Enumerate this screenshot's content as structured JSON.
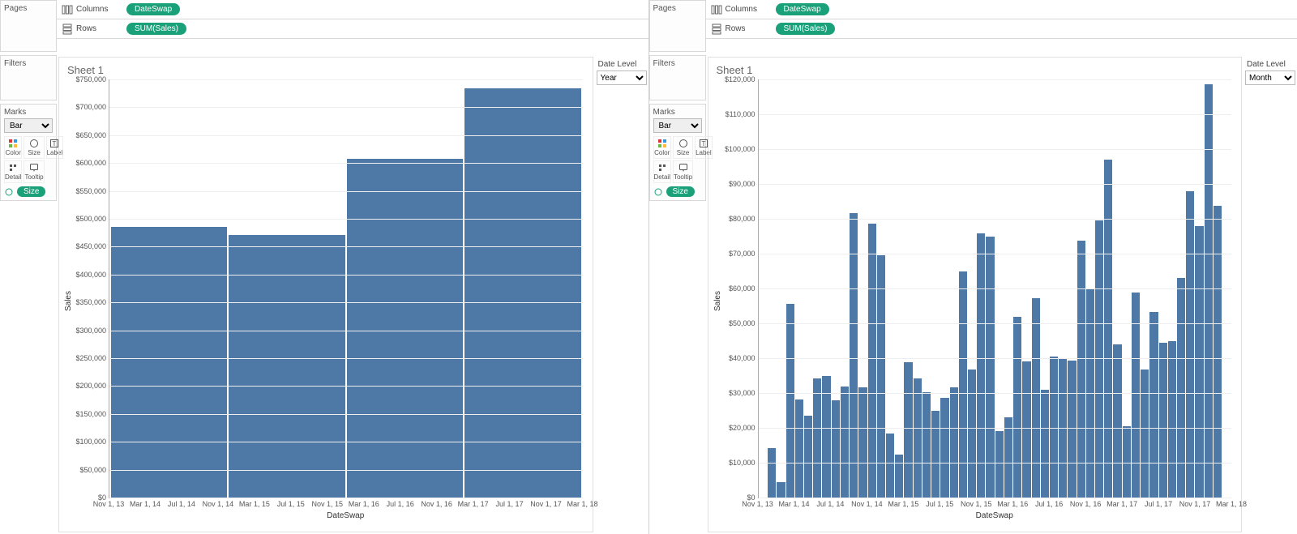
{
  "labels": {
    "pages": "Pages",
    "filters": "Filters",
    "marks": "Marks",
    "columns": "Columns",
    "rows": "Rows",
    "dateLevel": "Date Level",
    "sheet": "Sheet 1",
    "marksType": "Bar",
    "color": "Color",
    "size": "Size",
    "label": "Label",
    "detail": "Detail",
    "tooltip": "Tooltip",
    "sizePill": "Size"
  },
  "pills": {
    "columns": "DateSwap",
    "rows": "SUM(Sales)"
  },
  "paramValues": {
    "left": "Year",
    "right": "Month"
  },
  "axis": {
    "xlabel": "DateSwap",
    "ylabel": "Sales"
  },
  "chart_data": [
    {
      "type": "bar",
      "title": "Sheet 1",
      "xlabel": "DateSwap",
      "ylabel": "Sales",
      "ylim": [
        0,
        750000
      ],
      "yticks": [
        "$0",
        "$50,000",
        "$100,000",
        "$150,000",
        "$200,000",
        "$250,000",
        "$300,000",
        "$350,000",
        "$400,000",
        "$450,000",
        "$500,000",
        "$550,000",
        "$600,000",
        "$650,000",
        "$700,000",
        "$750,000"
      ],
      "x_ticks": [
        "Nov 1, 13",
        "Mar 1, 14",
        "Jul 1, 14",
        "Nov 1, 14",
        "Mar 1, 15",
        "Jul 1, 15",
        "Nov 1, 15",
        "Mar 1, 16",
        "Jul 1, 16",
        "Nov 1, 16",
        "Mar 1, 17",
        "Jul 1, 17",
        "Nov 1, 17",
        "Mar 1, 18"
      ],
      "values": [
        485000,
        471000,
        608000,
        734000
      ]
    },
    {
      "type": "bar",
      "title": "Sheet 1",
      "xlabel": "DateSwap",
      "ylabel": "Sales",
      "ylim": [
        0,
        120000
      ],
      "yticks": [
        "$0",
        "$10,000",
        "$20,000",
        "$30,000",
        "$40,000",
        "$50,000",
        "$60,000",
        "$70,000",
        "$80,000",
        "$90,000",
        "$100,000",
        "$110,000",
        "$120,000"
      ],
      "x_ticks": [
        "Nov 1, 13",
        "Mar 1, 14",
        "Jul 1, 14",
        "Nov 1, 14",
        "Mar 1, 15",
        "Jul 1, 15",
        "Nov 1, 15",
        "Mar 1, 16",
        "Jul 1, 16",
        "Nov 1, 16",
        "Mar 1, 17",
        "Jul 1, 17",
        "Nov 1, 17",
        "Mar 1, 18"
      ],
      "values": [
        14200,
        4400,
        55600,
        28200,
        23600,
        34300,
        34800,
        27800,
        31800,
        81600,
        31600,
        78500,
        69500,
        18400,
        12300,
        38900,
        34300,
        30300,
        25000,
        28500,
        31700,
        64800,
        36700,
        75900,
        74800,
        19000,
        23000,
        51800,
        39000,
        57300,
        31000,
        40500,
        40000,
        39200,
        73800,
        59800,
        79500,
        97000,
        44000,
        20500,
        58800,
        36700,
        53200,
        44500,
        45000,
        63000,
        87800,
        78000,
        118700,
        83700
      ]
    }
  ]
}
